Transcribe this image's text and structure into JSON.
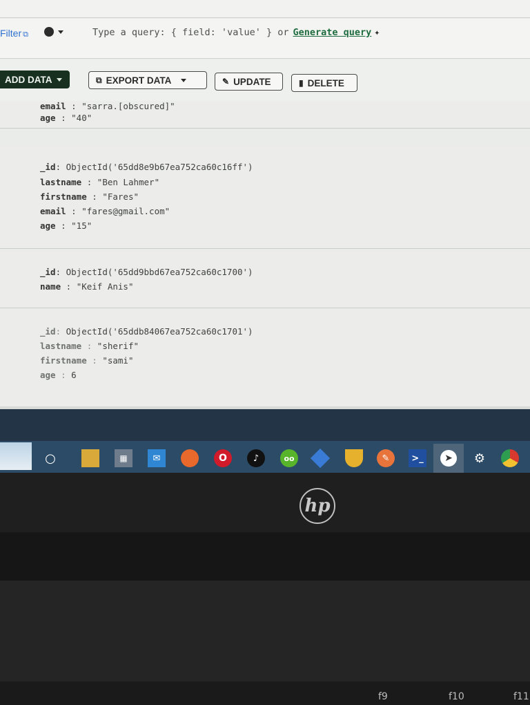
{
  "filter_bar": {
    "filter_label": "Filter",
    "query_placeholder": "Type a query: { field: 'value' } or",
    "generate_label": "Generate query"
  },
  "toolbar": {
    "add_label": "ADD DATA",
    "export_label": "EXPORT DATA",
    "update_label": "UPDATE",
    "delete_label": "DELETE"
  },
  "documents": [
    {
      "fields": [
        {
          "key": "email",
          "value": "\"sarra.[obscured]\""
        },
        {
          "key": "age",
          "value": "\"40\""
        }
      ]
    },
    {
      "fields": [
        {
          "key": "_id",
          "value": "ObjectId('65dd8e9b67ea752ca60c16ff')"
        },
        {
          "key": "lastname",
          "value": "\"Ben Lahmer\""
        },
        {
          "key": "firstname",
          "value": "\"Fares\""
        },
        {
          "key": "email",
          "value": "\"fares@gmail.com\""
        },
        {
          "key": "age",
          "value": "\"15\""
        }
      ]
    },
    {
      "fields": [
        {
          "key": "_id",
          "value": "ObjectId('65dd9bbd67ea752ca60c1700')"
        },
        {
          "key": "name",
          "value": "\"Keif Anis\""
        }
      ]
    },
    {
      "fields": [
        {
          "key": "_id",
          "value": "ObjectId('65ddb84067ea752ca60c1701')"
        },
        {
          "key": "lastname",
          "value": "\"sherif\""
        },
        {
          "key": "firstname",
          "value": "\"sami\""
        },
        {
          "key": "age",
          "value": "6"
        }
      ]
    }
  ],
  "taskbar": {
    "icons": [
      "search-icon",
      "file-explorer-icon",
      "store-icon",
      "mail-icon",
      "firefox-icon",
      "opera-icon",
      "tiktok-icon",
      "duolingo-icon",
      "app-icon",
      "award-icon",
      "brush-icon",
      "terminal-icon",
      "cursor-app-icon",
      "settings-icon",
      "chrome-icon"
    ]
  },
  "laptop": {
    "logo": "hp",
    "fkeys": [
      "f9",
      "f10",
      "f11"
    ]
  },
  "colors": {
    "accent_green": "#17301f",
    "link_blue": "#2f6fd0",
    "taskbar": "#2c4b66"
  }
}
